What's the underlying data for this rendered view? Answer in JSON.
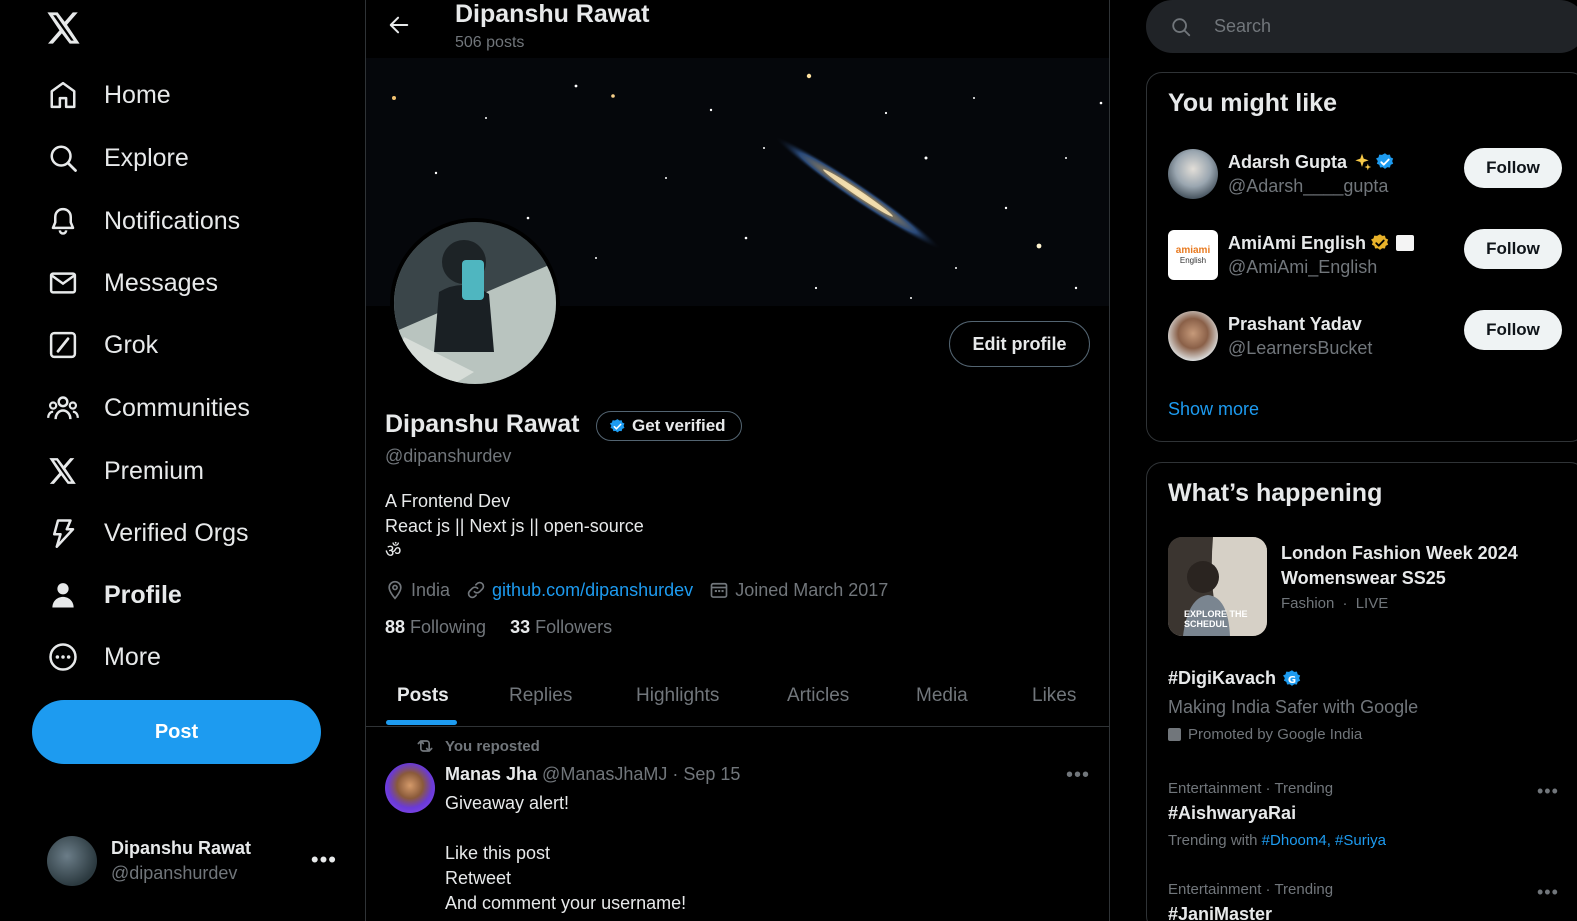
{
  "nav": {
    "items": [
      {
        "label": "Home",
        "icon": "home-icon"
      },
      {
        "label": "Explore",
        "icon": "search-icon"
      },
      {
        "label": "Notifications",
        "icon": "bell-icon"
      },
      {
        "label": "Messages",
        "icon": "mail-icon"
      },
      {
        "label": "Grok",
        "icon": "grok-icon"
      },
      {
        "label": "Communities",
        "icon": "communities-icon"
      },
      {
        "label": "Premium",
        "icon": "x-logo-icon"
      },
      {
        "label": "Verified Orgs",
        "icon": "lightning-icon"
      },
      {
        "label": "Profile",
        "icon": "person-icon"
      },
      {
        "label": "More",
        "icon": "more-circle-icon"
      }
    ],
    "post_label": "Post",
    "account": {
      "name": "Dipanshu Rawat",
      "handle": "@dipanshurdev",
      "menu": "•••"
    }
  },
  "header": {
    "name": "Dipanshu Rawat",
    "posts_count": "506 posts"
  },
  "profile": {
    "name": "Dipanshu Rawat",
    "get_verified": "Get verified",
    "handle": "@dipanshurdev",
    "edit_label": "Edit profile",
    "bio_lines": [
      "A Frontend Dev",
      "React js || Next js || open-source",
      "ॐ"
    ],
    "location": "India",
    "website": "github.com/dipanshurdev",
    "joined": "Joined March 2017",
    "following_count": "88",
    "following_label": "Following",
    "followers_count": "33",
    "followers_label": "Followers"
  },
  "tabs": [
    "Posts",
    "Replies",
    "Highlights",
    "Articles",
    "Media",
    "Likes"
  ],
  "tweet": {
    "repost_label": "You reposted",
    "author": "Manas Jha",
    "handle": "@ManasJhaMJ",
    "sep": "·",
    "date": "Sep 15",
    "menu": "•••",
    "lines": [
      "Giveaway alert!",
      "",
      "Like this post",
      "Retweet",
      "And comment your username!"
    ]
  },
  "search": {
    "placeholder": "Search"
  },
  "might_like": {
    "title": "You might like",
    "users": [
      {
        "name": "Adarsh Gupta",
        "handle": "@Adarsh____gupta",
        "follow": "Follow"
      },
      {
        "name": "AmiAmi English",
        "handle": "@AmiAmi_English",
        "follow": "Follow",
        "logo_text_1": "amiami",
        "logo_text_2": "English"
      },
      {
        "name": "Prashant Yadav",
        "handle": "@LearnersBucket",
        "follow": "Follow"
      }
    ],
    "show_more": "Show more"
  },
  "happening": {
    "title": "What’s happening",
    "event": {
      "title": "London Fashion Week 2024 Womenswear SS25",
      "category": "Fashion",
      "sep": "·",
      "status": "LIVE",
      "image_text": "EXPLORE THE SCHEDUL"
    },
    "promoted": {
      "name": "#DigiKavach",
      "desc": "Making India Safer with Google",
      "by": "Promoted by Google India"
    },
    "trends": [
      {
        "meta": "Entertainment · Trending",
        "name": "#AishwaryaRai",
        "with_prefix": "Trending with",
        "with_tags": "#Dhoom4, #Suriya",
        "menu": "•••"
      },
      {
        "meta": "Entertainment · Trending",
        "name": "#JaniMaster",
        "menu": "•••"
      }
    ]
  },
  "colors": {
    "accent": "#1d9bf0",
    "background": "#000000",
    "muted": "#71767b",
    "verified_gold": "#e8b22a"
  }
}
